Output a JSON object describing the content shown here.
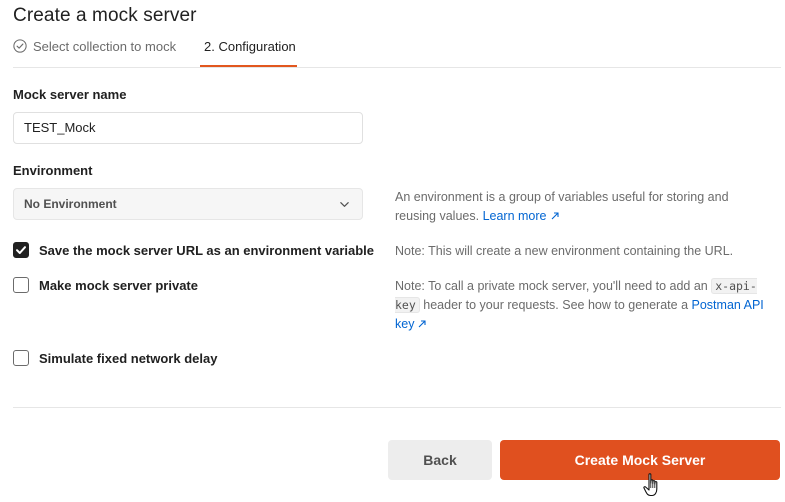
{
  "page": {
    "title": "Create a mock server"
  },
  "tabs": [
    {
      "label": "Select collection to mock",
      "state": "completed"
    },
    {
      "label": "2. Configuration",
      "state": "active"
    }
  ],
  "form": {
    "name_label": "Mock server name",
    "name_value": "TEST_Mock",
    "environment_label": "Environment",
    "environment_value": "No Environment",
    "options": [
      {
        "label": "Save the mock server URL as an environment variable",
        "checked": true
      },
      {
        "label": "Make mock server private",
        "checked": false
      },
      {
        "label": "Simulate fixed network delay",
        "checked": false
      }
    ]
  },
  "help": {
    "environment_text": "An environment is a group of variables useful for storing and reusing values.",
    "environment_link": "Learn more",
    "save_url_note": "Note: This will create a new environment containing the URL.",
    "private_note_before": "Note: To call a private mock server, you'll need to add an",
    "private_note_code": "x-api-key",
    "private_note_after": "header to your requests. See how to generate a",
    "private_note_link": "Postman API key"
  },
  "buttons": {
    "back": "Back",
    "create": "Create Mock Server"
  },
  "colors": {
    "accent": "#e0501f",
    "link": "#0265d2"
  },
  "icons": {
    "completed_step": "check-circle-icon",
    "select": "chevron-down-icon",
    "external_link": "arrow-up-right-icon",
    "cursor": "hand-pointer-icon"
  }
}
